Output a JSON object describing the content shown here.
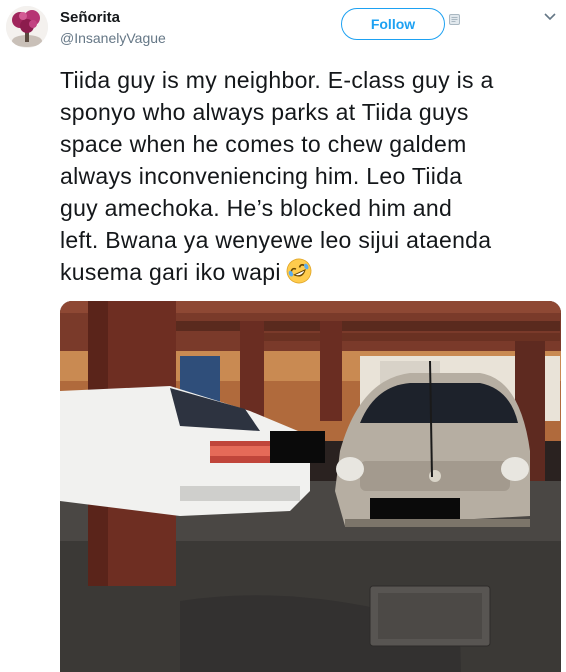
{
  "user": {
    "name": "Señorita",
    "handle": "@InsanelyVague"
  },
  "follow_button": {
    "label": "Follow"
  },
  "icons": {
    "follow_badge": "twitter-follow-icon",
    "menu_caret": "chevron-down-icon",
    "emoji": "rolling-on-floor-laughing-emoji"
  },
  "tweet": {
    "text_lines": [
      "Tiida guy is my neighbor. E-class guy is a",
      "sponyo who always parks at Tiida guys",
      "space when he comes to chew galdem",
      "always inconveniencing him. Leo Tiida",
      "guy amechoka. He’s blocked him and",
      "left. Bwana ya wenyewe leo sijui ataenda",
      "kusema gari iko wapi"
    ]
  },
  "colors": {
    "accent": "#1da1f2",
    "text": "#14171a",
    "secondary": "#657786"
  }
}
